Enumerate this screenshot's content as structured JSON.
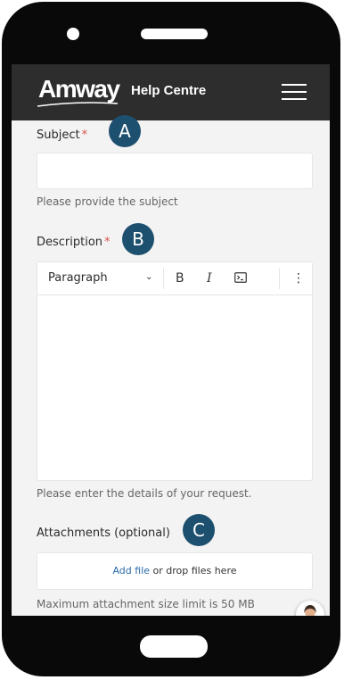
{
  "header": {
    "logo_text": "Amway",
    "title": "Help Centre"
  },
  "form": {
    "subject": {
      "label": "Subject",
      "required_mark": "*",
      "hint": "Please provide the subject",
      "value": ""
    },
    "description": {
      "label": "Description",
      "required_mark": "*",
      "hint": "Please enter the details of your request.",
      "toolbar": {
        "block_format": "Paragraph",
        "bold": "B",
        "italic": "I",
        "more": "⋮"
      }
    },
    "attachments": {
      "label": "Attachments (optional)",
      "add_file": "Add file",
      "drop_text": " or drop files here",
      "hint": "Maximum attachment size limit is 50 MB"
    }
  },
  "annotations": {
    "a": "A",
    "b": "B",
    "c": "C"
  },
  "colors": {
    "header_bg": "#2d2d2d",
    "badge_bg": "#1d4f6e",
    "required": "#d9534f",
    "link": "#2a6aa8"
  }
}
